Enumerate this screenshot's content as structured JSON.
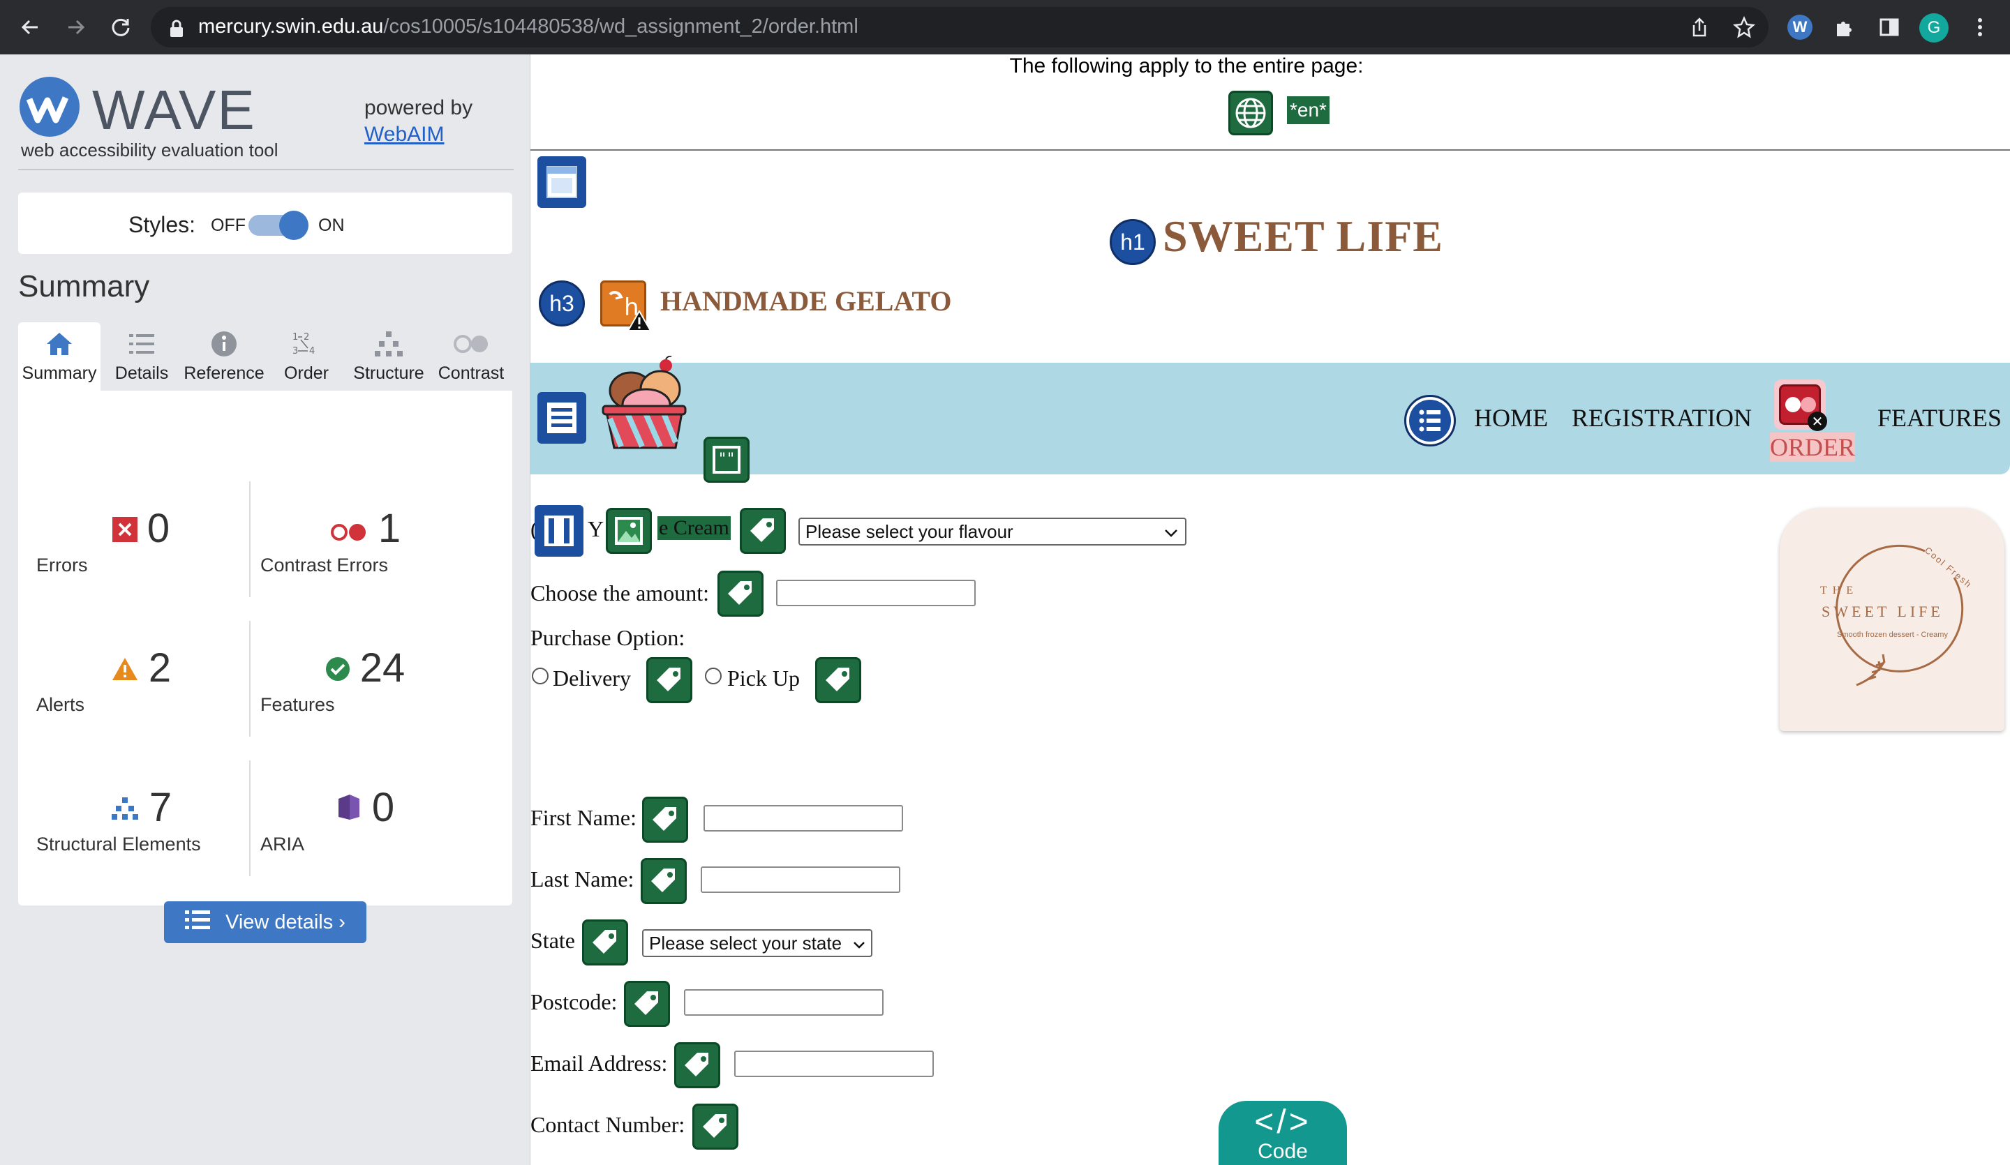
{
  "browser": {
    "url_domain": "mercury.swin.edu.au",
    "url_path": "/cos10005/s104480538/wd_assignment_2/order.html",
    "avatar_letter": "G"
  },
  "wave": {
    "logo_word": "WAVE",
    "logo_sub": "web accessibility evaluation tool",
    "powered_by": "powered by",
    "webaim": "WebAIM",
    "styles_label": "Styles:",
    "off": "OFF",
    "on": "ON",
    "summary_heading": "Summary",
    "tabs": [
      "Summary",
      "Details",
      "Reference",
      "Order",
      "Structure",
      "Contrast"
    ],
    "stats": {
      "errors": {
        "count": "0",
        "label": "Errors"
      },
      "contrast": {
        "count": "1",
        "label": "Contrast Errors"
      },
      "alerts": {
        "count": "2",
        "label": "Alerts"
      },
      "features": {
        "count": "24",
        "label": "Features"
      },
      "structural": {
        "count": "7",
        "label": "Structural Elements"
      },
      "aria": {
        "count": "0",
        "label": "ARIA"
      }
    },
    "view_details": "View details ›"
  },
  "page": {
    "entire_page_text": "The following apply to the entire page:",
    "lang_tag": "*en*",
    "title": "SWEET LIFE",
    "subtitle": "HANDMADE GELATO",
    "nav": [
      "HOME",
      "REGISTRATION",
      "ORDER",
      "FEATURES"
    ],
    "flavour_label_fragments": [
      "(",
      "Y",
      "e Cream"
    ],
    "flavour_select": "Please select your flavour",
    "amount_label": "Choose the amount:",
    "purchase_label": "Purchase Option:",
    "delivery": "Delivery",
    "pickup": "Pick Up",
    "first_name": "First Name:",
    "last_name": "Last Name:",
    "state": "State",
    "state_select": "Please select your state",
    "postcode": "Postcode:",
    "email": "Email Address:",
    "contact": "Contact Number:",
    "logo_badge": {
      "the": "THE",
      "name": "SWEET LIFE",
      "tagline": "Smooth frozen dessert - Creamy",
      "arc_text": "Cool Fresh"
    },
    "code_button": "Code",
    "code_glyph": "</>"
  },
  "colors": {
    "wave_blue": "#3e78c4",
    "feature_green": "#1d6b3e",
    "brand_brown": "#8a5a3a",
    "nav_band": "#add8e4"
  }
}
